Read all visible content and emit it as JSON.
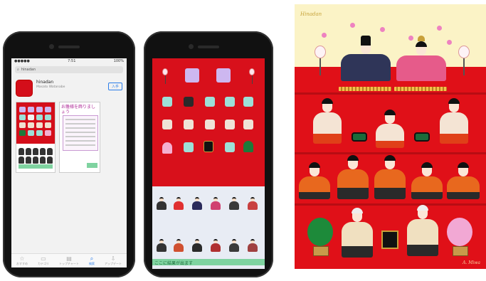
{
  "appstore": {
    "status_carrier": "●●●●● ",
    "status_time": "7:51",
    "status_battery": "100%",
    "search_query": "hinadan",
    "app_name": "hinadan",
    "app_author": "Masato Watanabe",
    "get_label": "入手",
    "shot2_title": "お雛様を飾りましょう",
    "tabs": [
      {
        "icon": "☆",
        "label": "おすすめ"
      },
      {
        "icon": "▭",
        "label": "カテゴリ"
      },
      {
        "icon": "▤",
        "label": "トップチャート"
      },
      {
        "icon": "⌕",
        "label": "検索"
      },
      {
        "icon": "⇩",
        "label": "アップデート"
      }
    ]
  },
  "app": {
    "status_text": "ここに結果が出ます"
  },
  "poster": {
    "signature_top": "Hinadan",
    "signature_bottom": "A. Miwa"
  },
  "colors": {
    "red": "#d8101b",
    "cream": "#fbf3c6",
    "mint": "#7fd3a0",
    "blue": "#2b7de9"
  }
}
